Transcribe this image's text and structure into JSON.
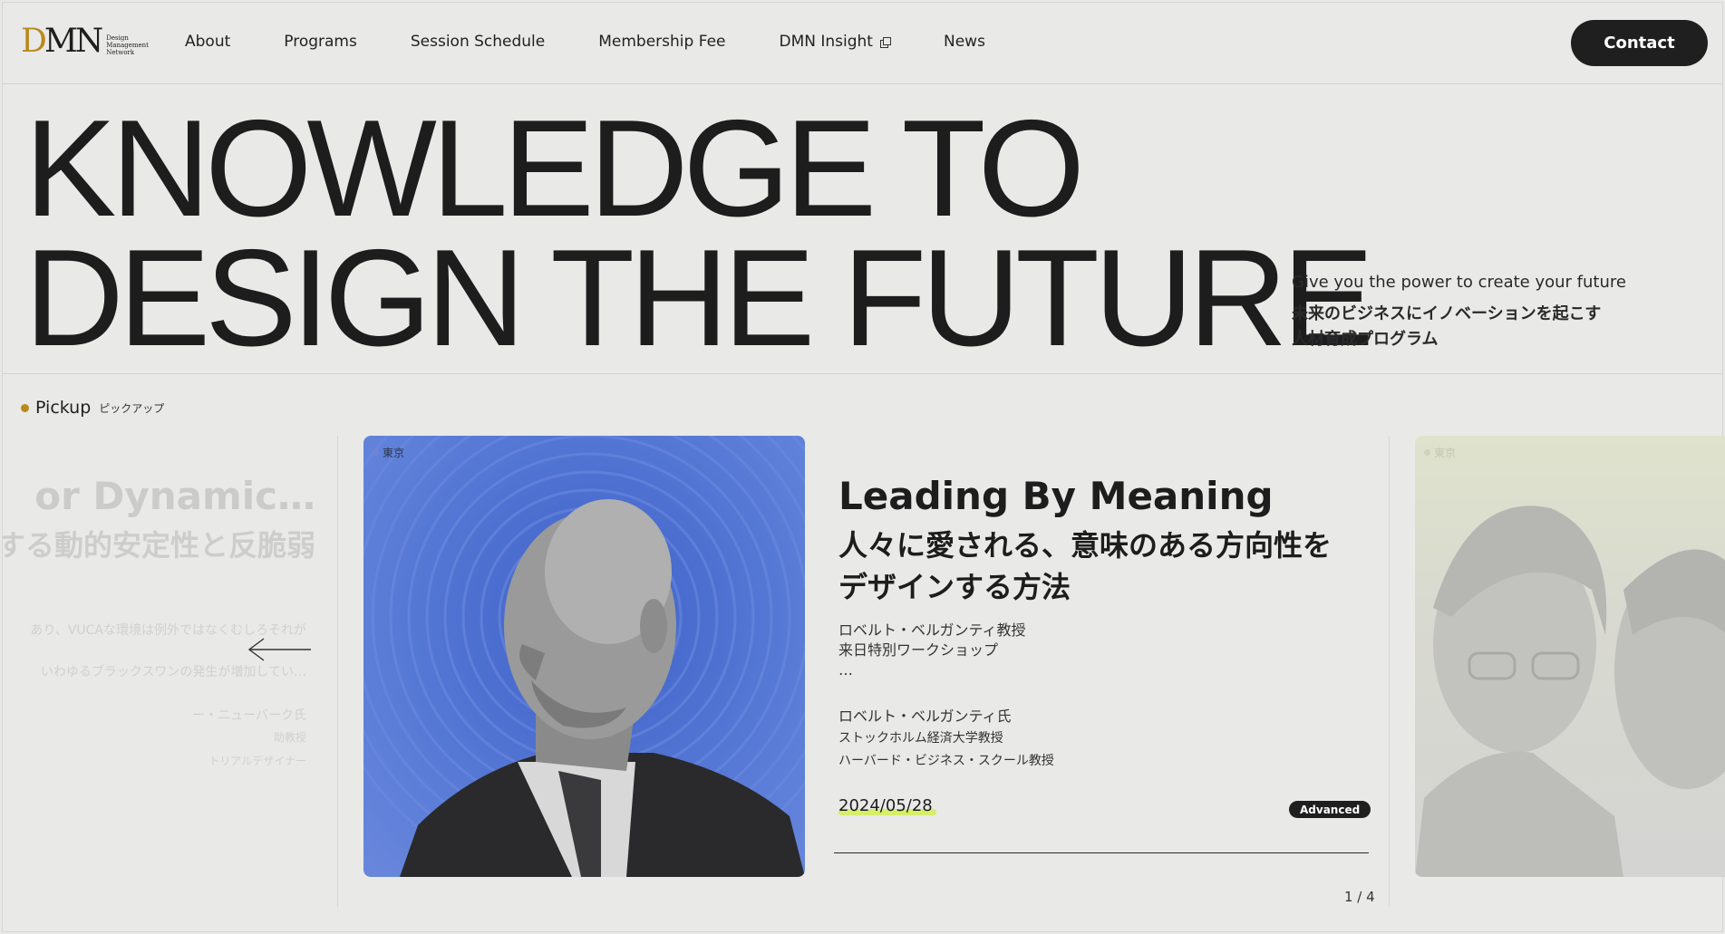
{
  "header": {
    "logo": {
      "mark_d": "D",
      "mark_mn": "MN",
      "line1": "Design",
      "line2": "Management",
      "line3": "Network"
    },
    "nav": [
      {
        "label": "About"
      },
      {
        "label": "Programs"
      },
      {
        "label": "Session Schedule"
      },
      {
        "label": "Membership Fee"
      },
      {
        "label": "DMN Insight",
        "icon": "external-link-icon"
      },
      {
        "label": "News"
      }
    ],
    "contact_label": "Contact"
  },
  "hero": {
    "line1": "KNOWLEDGE TO",
    "line2": "DESIGN THE FUTURE",
    "tagline": "Give you the power to create your future",
    "tagline_jp_1": "未来のビジネスにイノベーションを起こす",
    "tagline_jp_2": "人材育成プログラム"
  },
  "pickup": {
    "title": "Pickup",
    "title_jp": "ピックアップ",
    "prev_slide": {
      "title": "or Dynamic…",
      "subtitle": "する動的安定性と反脆弱",
      "desc1": "あり、VUCAな環境は例外ではなくむしろそれが",
      "desc2": "いわゆるブラックスワンの発生が増加してい…",
      "person": "ー・ニューバーク氏",
      "role1": "助教授",
      "role2": "トリアルデザイナー"
    },
    "card": {
      "tag": "東京",
      "title": "Leading By Meaning",
      "subtitle_1": "人々に愛される、意味のある方向性を",
      "subtitle_2": "デザインする方法",
      "desc_1": "ロベルト・ベルガンティ教授",
      "desc_2": "来日特別ワークショップ",
      "desc_3": "…",
      "person_name": "ロベルト・ベルガンティ氏",
      "person_role_1": "ストックホルム経済大学教授",
      "person_role_2": "ハーバード・ビジネス・スクール教授",
      "date": "2024/05/28",
      "level": "Advanced"
    },
    "next_slide": {
      "tag": "東京"
    },
    "pager": "1 / 4"
  },
  "colors": {
    "accent_gold": "#b88a1b",
    "card_blue": "#4c6fd0",
    "date_highlight": "#d6ee6a",
    "dark": "#1f1f1f"
  }
}
